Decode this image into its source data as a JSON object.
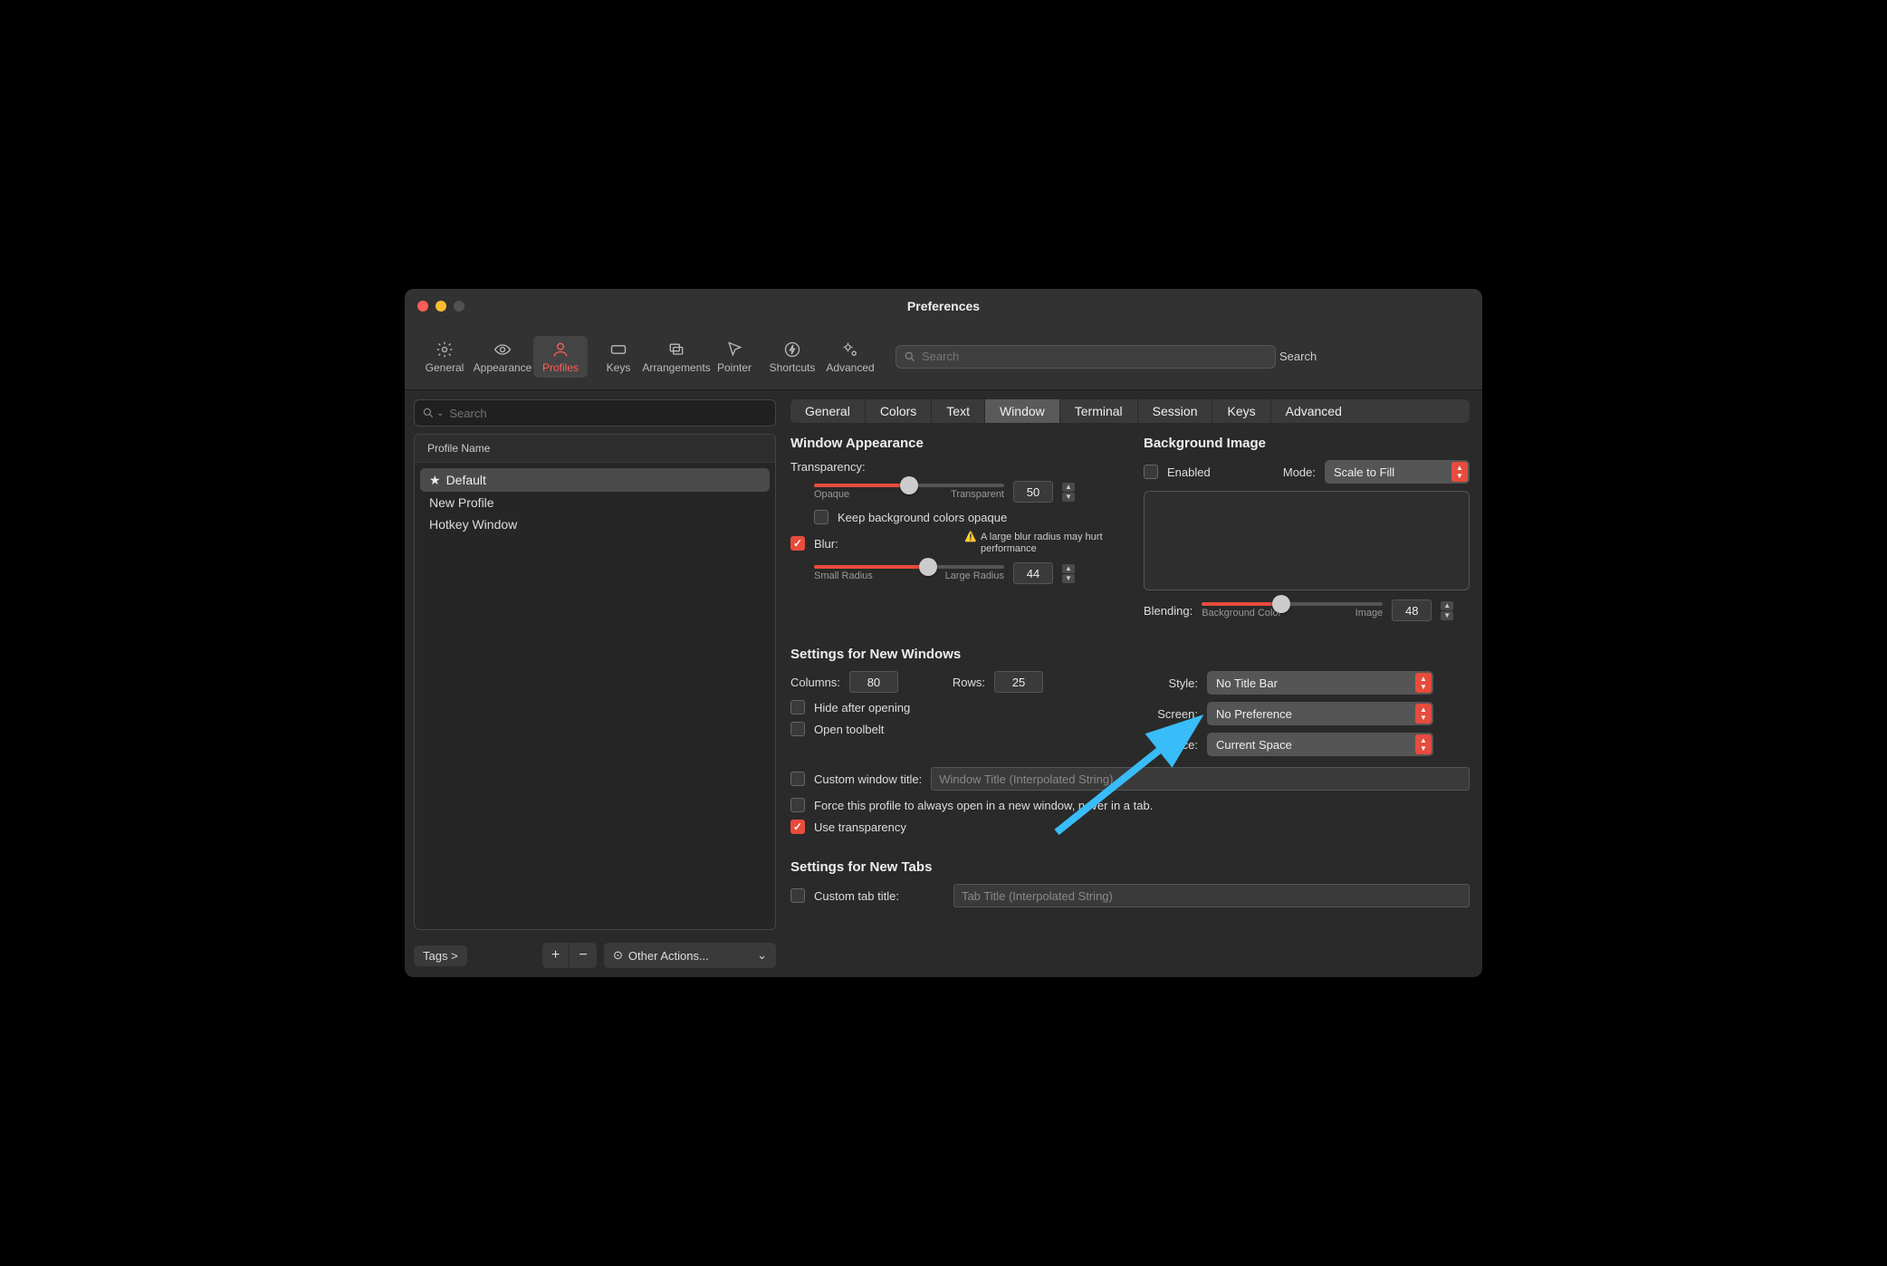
{
  "title": "Preferences",
  "toolbar": {
    "items": [
      {
        "id": "general",
        "label": "General"
      },
      {
        "id": "appearance",
        "label": "Appearance"
      },
      {
        "id": "profiles",
        "label": "Profiles"
      },
      {
        "id": "keys",
        "label": "Keys"
      },
      {
        "id": "arrangements",
        "label": "Arrangements"
      },
      {
        "id": "pointer",
        "label": "Pointer"
      },
      {
        "id": "shortcuts",
        "label": "Shortcuts"
      },
      {
        "id": "advanced",
        "label": "Advanced"
      }
    ],
    "active": "profiles",
    "search_placeholder": "Search",
    "search_label": "Search"
  },
  "sidebar": {
    "search_placeholder": "Search",
    "header": "Profile Name",
    "profiles": [
      {
        "name": "Default",
        "star": true,
        "selected": true
      },
      {
        "name": "New Profile",
        "star": false,
        "selected": false
      },
      {
        "name": "Hotkey Window",
        "star": false,
        "selected": false
      }
    ],
    "tags_label": "Tags >",
    "other_actions_label": "Other Actions..."
  },
  "tabs": {
    "items": [
      "General",
      "Colors",
      "Text",
      "Window",
      "Terminal",
      "Session",
      "Keys",
      "Advanced"
    ],
    "active": "Window"
  },
  "window_appearance": {
    "section": "Window Appearance",
    "transparency_label": "Transparency:",
    "transparency_value": "50",
    "transparency_min": "Opaque",
    "transparency_max": "Transparent",
    "keep_bg_label": "Keep background colors opaque",
    "keep_bg_checked": false,
    "blur_label": "Blur:",
    "blur_checked": true,
    "blur_warning": "A large blur radius may hurt performance",
    "blur_value": "44",
    "blur_min": "Small Radius",
    "blur_max": "Large Radius"
  },
  "background_image": {
    "section": "Background Image",
    "enabled_label": "Enabled",
    "enabled_checked": false,
    "mode_label": "Mode:",
    "mode_value": "Scale to Fill",
    "blending_label": "Blending:",
    "blending_value": "48",
    "blending_min": "Background Color",
    "blending_max": "Image"
  },
  "new_windows": {
    "section": "Settings for New Windows",
    "columns_label": "Columns:",
    "columns_value": "80",
    "rows_label": "Rows:",
    "rows_value": "25",
    "style_label": "Style:",
    "style_value": "No Title Bar",
    "screen_label": "Screen:",
    "screen_value": "No Preference",
    "space_label": "Space:",
    "space_value": "Current Space",
    "hide_label": "Hide after opening",
    "hide_checked": false,
    "toolbelt_label": "Open toolbelt",
    "toolbelt_checked": false,
    "custom_title_label": "Custom window title:",
    "custom_title_checked": false,
    "custom_title_placeholder": "Window Title (Interpolated String)",
    "force_label": "Force this profile to always open in a new window, never in a tab.",
    "force_checked": false,
    "use_transparency_label": "Use transparency",
    "use_transparency_checked": true
  },
  "new_tabs": {
    "section": "Settings for New Tabs",
    "custom_tab_label": "Custom tab title:",
    "custom_tab_checked": false,
    "custom_tab_placeholder": "Tab Title (Interpolated String)"
  }
}
